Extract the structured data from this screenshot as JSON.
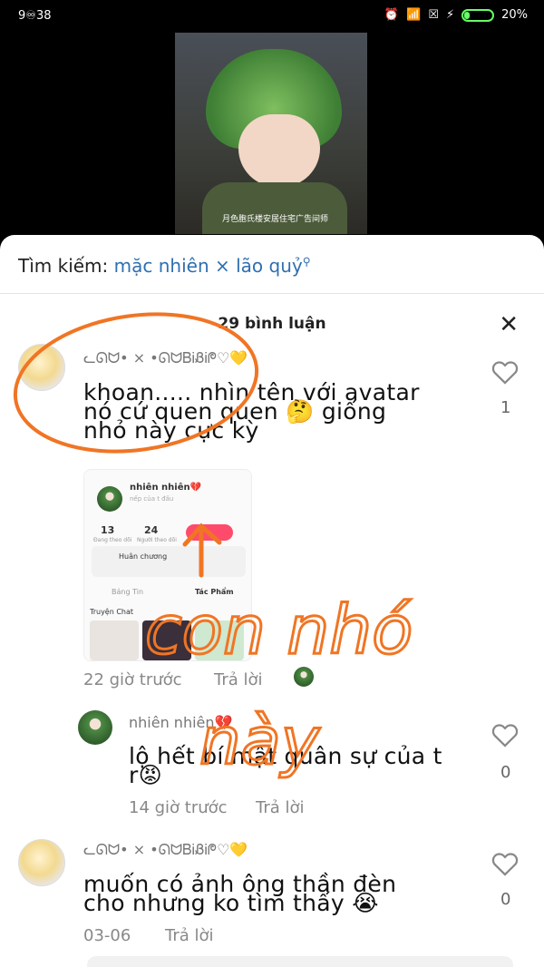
{
  "status_bar": {
    "time": "9",
    "time_suffix": "38",
    "battery": "20%",
    "colors": {
      "battery": "#66ff66"
    }
  },
  "video": {
    "caption": "月色胞氏楼安居住宅广告间师"
  },
  "search": {
    "prefix": "Tìm kiếm:",
    "query": "mặc nhiên × lão quỷ",
    "icon": "search-icon"
  },
  "comments_header": {
    "count_label": "29 bình luận",
    "close_icon": "close-icon"
  },
  "comments": [
    {
      "username": "ᓚᘏᗢ• × •ᘏᗢᏴᎥᏰᎥᖘ♡💛",
      "text_line1": "khoan..... nhìn tên với avatar",
      "text_line2": "nó cứ quen quen 🤔 giống",
      "text_line3": "nhỏ này cực kỳ",
      "time": "22 giờ trước",
      "reply_label": "Trả lời",
      "likes": "1"
    },
    {
      "username": "nhiên nhiên💔",
      "text_line1": "lộ hết bí mật quân sự của t",
      "text_line2": "r😡",
      "time": "14 giờ trước",
      "reply_label": "Trả lời",
      "likes": "0"
    },
    {
      "username": "ᓚᘏᗢ• × •ᘏᗢᏴᎥᏰᎥᖘ♡💛",
      "text_line1": "muốn có ảnh ông thần đèn",
      "text_line2": "cho nhưng ko tìm thấy 😭",
      "time": "03-06",
      "reply_label": "Trả lời",
      "likes": "0"
    }
  ],
  "embedded_profile": {
    "name": "nhiên nhiên💔",
    "subtitle": "nếp của t đấu",
    "following_count": "13",
    "following_label": "Đang theo dõi",
    "followers_count": "24",
    "followers_label": "Người theo dõi",
    "medal_label": "Huân chương",
    "tab1": "Bảng Tin",
    "tab2": "Tác Phẩm",
    "section": "Truyện Chat"
  },
  "annotation": {
    "handwriting": "con nhỏ này",
    "color": "#f07524"
  }
}
